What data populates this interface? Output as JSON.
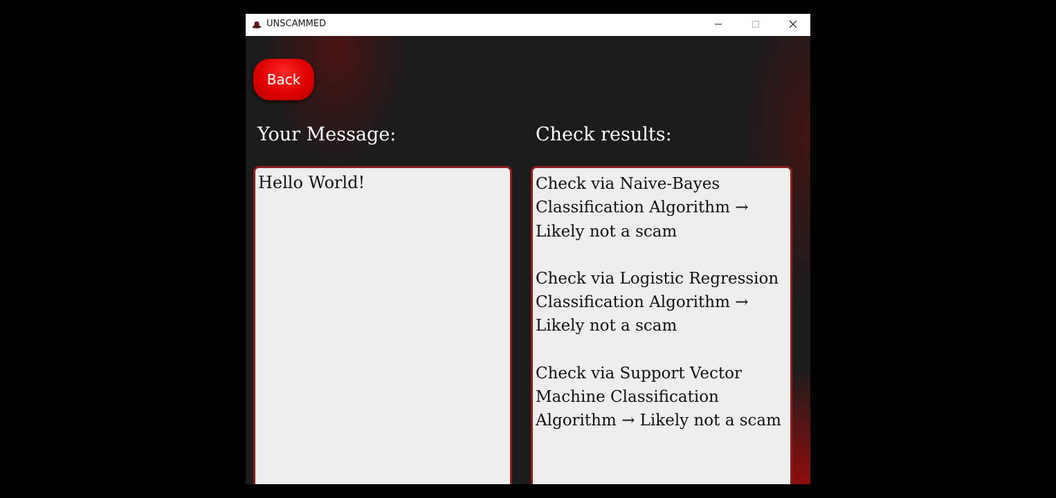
{
  "window": {
    "title": "UNSCAMMED",
    "app_icon": "hat-icon"
  },
  "controls": {
    "minimize_icon": "minimize-icon",
    "maximize_icon": "maximize-icon",
    "close_icon": "close-icon"
  },
  "toolbar": {
    "back_label": "Back"
  },
  "message_section": {
    "label": "Your Message:",
    "value": "Hello World!"
  },
  "results_section": {
    "label": "Check results:",
    "results": [
      "Check via Naive-Bayes Classification Algorithm → Likely not a scam",
      "Check via Logistic Regression Classification Algorithm → Likely not a scam",
      "Check via Support Vector Machine Classification Algorithm → Likely not a scam"
    ]
  },
  "colors": {
    "accent_red": "#e00000",
    "border_red": "#8a1e1e",
    "background": "#1c1c1c",
    "panel": "#eeeeee"
  }
}
